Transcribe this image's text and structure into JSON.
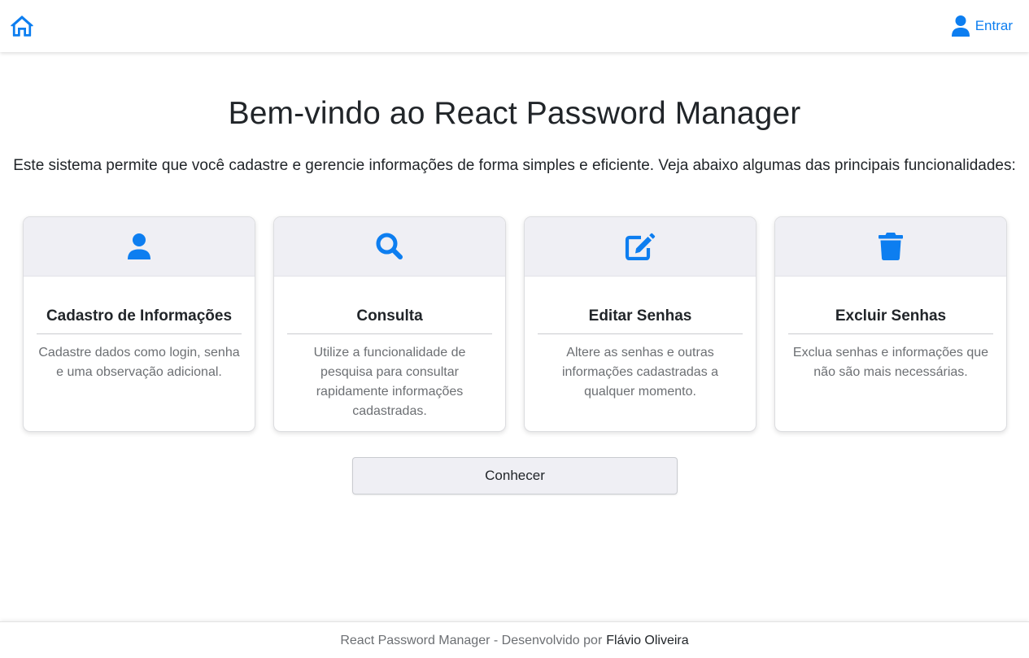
{
  "navbar": {
    "home_icon": "home-icon",
    "login_icon": "user-icon",
    "login_label": "Entrar",
    "accent_color": "#0d7ef0"
  },
  "main": {
    "title": "Bem-vindo ao React Password Manager",
    "intro": "Este sistema permite que você cadastre e gerencie informações de forma simples e eficiente. Veja abaixo algumas das principais funcionalidades:",
    "cards": [
      {
        "icon": "user-icon",
        "title": "Cadastro de Informações",
        "text": "Cadastre dados como login, senha e uma observação adicional."
      },
      {
        "icon": "search-icon",
        "title": "Consulta",
        "text": "Utilize a funcionalidade de pesquisa para consultar rapidamente informações cadastradas."
      },
      {
        "icon": "edit-icon",
        "title": "Editar Senhas",
        "text": "Altere as senhas e outras informações cadastradas a qualquer momento."
      },
      {
        "icon": "trash-icon",
        "title": "Excluir Senhas",
        "text": "Exclua senhas e informações que não são mais necessárias."
      }
    ],
    "cta_label": "Conhecer"
  },
  "footer": {
    "text": "React Password Manager - Desenvolvido por",
    "author": "Flávio Oliveira"
  }
}
